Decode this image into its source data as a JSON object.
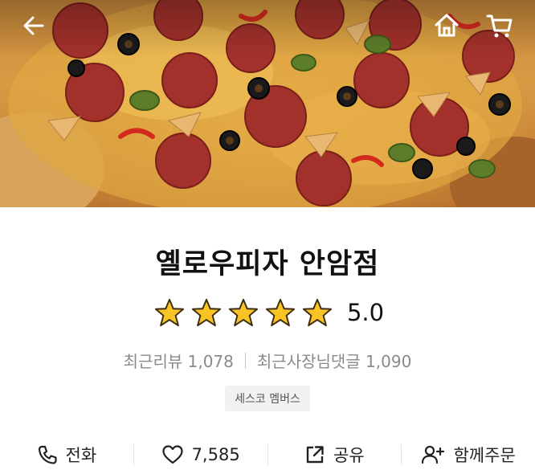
{
  "nav": {
    "back_icon": "arrow-left-icon",
    "home_icon": "home-icon",
    "cart_icon": "cart-icon"
  },
  "store": {
    "name": "옐로우피자 안암점",
    "rating": "5.0",
    "star_count": 5,
    "star_color": "#f7c325",
    "recent_reviews_label": "최근리뷰 1,078",
    "recent_owner_comments_label": "최근사장님댓글 1,090",
    "badge": "세스코 멤버스"
  },
  "actions": {
    "call": {
      "label": "전화",
      "icon": "phone-icon"
    },
    "like": {
      "label": "7,585",
      "icon": "heart-icon"
    },
    "share": {
      "label": "공유",
      "icon": "share-icon"
    },
    "group_order": {
      "label": "함께주문",
      "icon": "add-user-icon"
    }
  }
}
